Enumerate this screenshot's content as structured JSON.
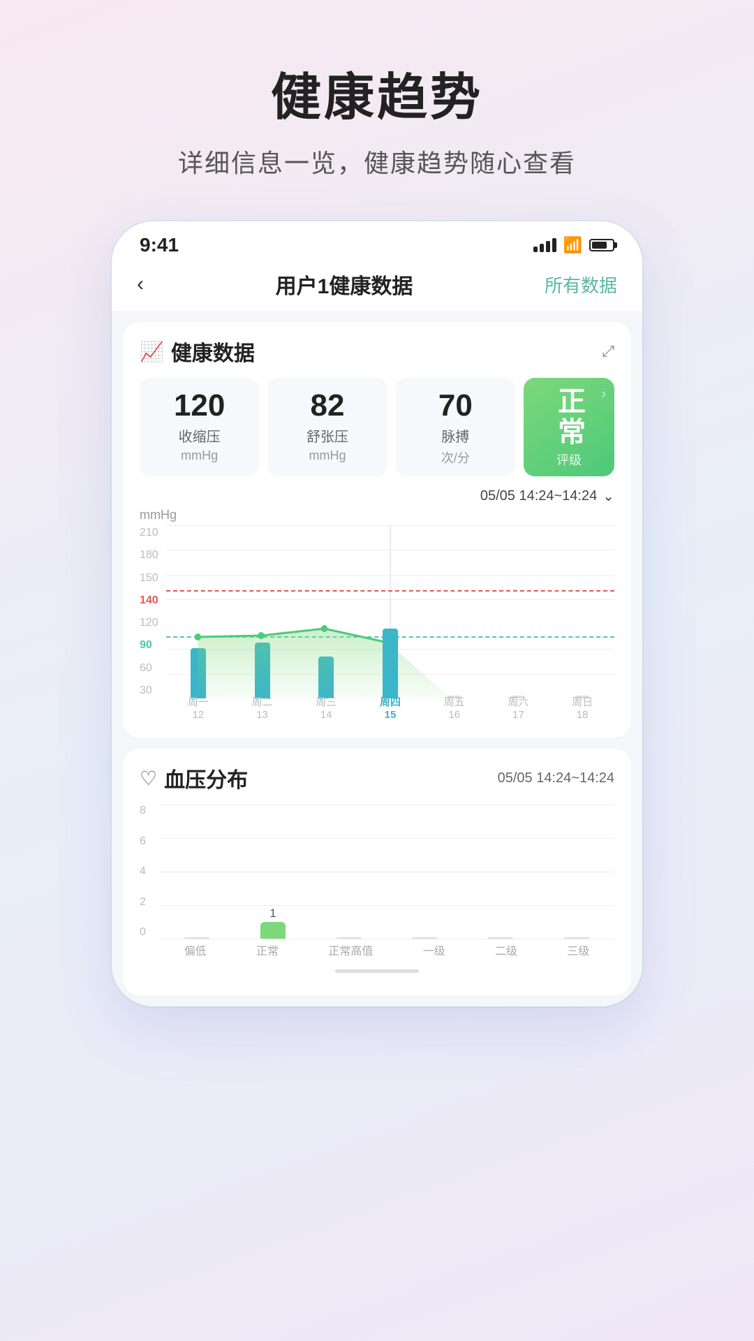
{
  "page": {
    "title": "健康趋势",
    "subtitle": "详细信息一览，健康趋势随心查看"
  },
  "phone": {
    "status_bar": {
      "time": "9:41",
      "signal": "signal",
      "wifi": "wifi",
      "battery": "battery"
    },
    "nav": {
      "back_label": "‹",
      "title": "用户1健康数据",
      "action": "所有数据"
    },
    "health_card": {
      "icon": "📈",
      "title": "健康数据",
      "expand": "⤢",
      "metrics": {
        "systolic": {
          "value": "120",
          "label": "收缩压",
          "unit": "mmHg"
        },
        "diastolic": {
          "value": "82",
          "label": "舒张压",
          "unit": "mmHg"
        },
        "pulse": {
          "value": "70",
          "label": "脉搏",
          "unit": "次/分"
        },
        "status": {
          "text": "正常",
          "sub_label": "评级"
        }
      },
      "chart": {
        "unit": "mmHg",
        "date_range": "05/05 14:24~14:24",
        "ref_140": "140",
        "ref_90": "90",
        "y_labels": [
          "210",
          "180",
          "150",
          "140",
          "120",
          "90",
          "60",
          "30"
        ],
        "x_labels": [
          {
            "day": "周一",
            "date": "12",
            "active": false
          },
          {
            "day": "周二",
            "date": "13",
            "active": false
          },
          {
            "day": "周三",
            "date": "14",
            "active": false
          },
          {
            "day": "周四",
            "date": "15",
            "active": true
          },
          {
            "day": "周五",
            "date": "16",
            "active": false
          },
          {
            "day": "周六",
            "date": "17",
            "active": false
          },
          {
            "day": "周日",
            "date": "18",
            "active": false
          }
        ]
      }
    },
    "bp_dist_card": {
      "icon": "♡",
      "title": "血压分布",
      "date_range": "05/05 14:24~14:24",
      "chart": {
        "y_labels": [
          "8",
          "6",
          "4",
          "2",
          "0"
        ],
        "x_labels": [
          "偏低",
          "正常",
          "正常高值",
          "一级",
          "二级",
          "三级"
        ],
        "bars": [
          {
            "label": "",
            "value": 0,
            "color": "#aaa"
          },
          {
            "label": "1",
            "value": 1,
            "color": "#7dd87a"
          },
          {
            "label": "",
            "value": 0,
            "color": "#aaa"
          },
          {
            "label": "",
            "value": 0,
            "color": "#aaa"
          },
          {
            "label": "",
            "value": 0,
            "color": "#aaa"
          },
          {
            "label": "",
            "value": 0,
            "color": "#aaa"
          }
        ]
      }
    }
  }
}
